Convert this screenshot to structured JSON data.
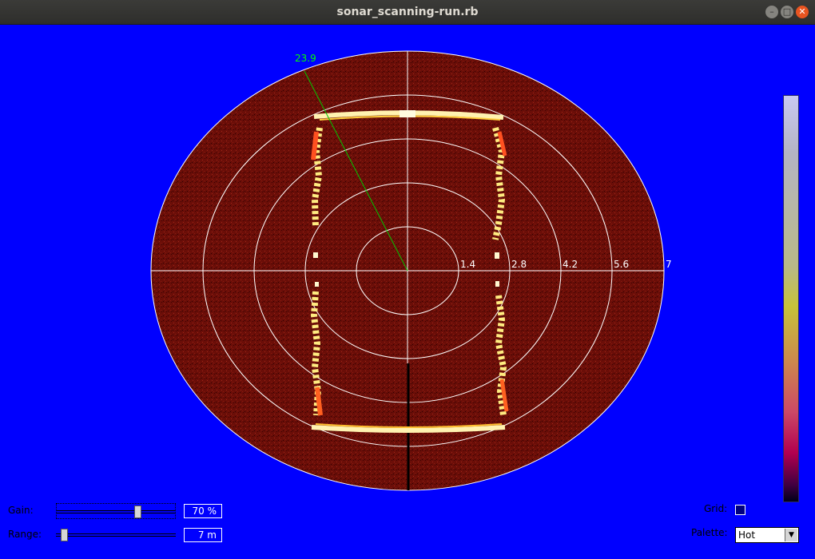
{
  "window": {
    "title": "sonar_scanning-run.rb"
  },
  "sonar": {
    "range_rings": [
      "1.4",
      "2.8",
      "4.2",
      "5.6",
      "7"
    ],
    "bearing_label": "23.9",
    "background_color": "#6b0e08",
    "grid_color": "#ffffff",
    "bearing_color": "#00c800"
  },
  "controls": {
    "gain_label": "Gain:",
    "gain_value": "70 %",
    "gain_level": 0.7,
    "range_label": "Range:",
    "range_value": "7 m",
    "grid_label": "Grid:",
    "palette_label": "Palette:",
    "palette_value": "Hot"
  },
  "colors": {
    "background": "#0000ff"
  }
}
